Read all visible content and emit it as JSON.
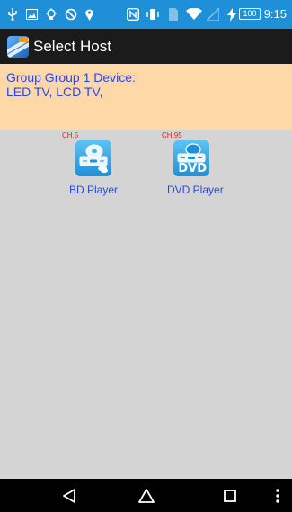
{
  "status_bar": {
    "time": "9:15",
    "battery": "100",
    "color": "#1f8fd7"
  },
  "app_bar": {
    "title": "Select Host"
  },
  "info": {
    "line1": "Group Group 1 Device:",
    "line2": "LED TV, LCD TV,"
  },
  "devices": [
    {
      "channel": "CH.5",
      "name": "BD Player",
      "icon": "bd-player-icon"
    },
    {
      "channel": "CH.95",
      "name": "DVD Player",
      "icon": "dvd-player-icon",
      "icon_label": "DVD"
    }
  ],
  "nav": {
    "back": "back-icon",
    "home": "home-icon",
    "recents": "recents-icon",
    "menu": "overflow-menu-icon"
  }
}
